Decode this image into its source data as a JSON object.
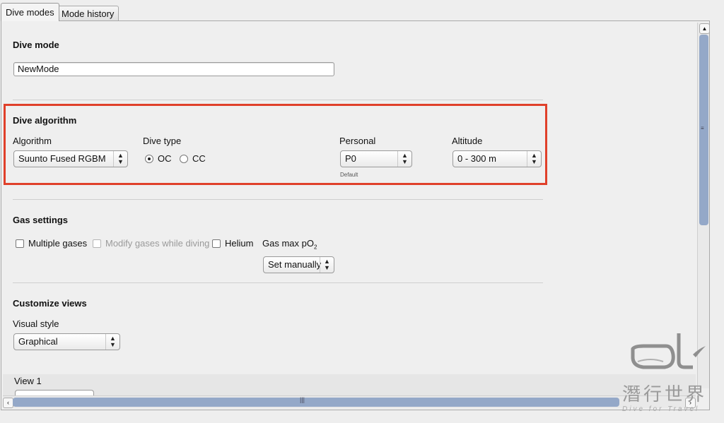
{
  "tabs": {
    "active": "Dive modes",
    "inactive": "Mode history"
  },
  "dive_mode": {
    "title": "Dive mode",
    "value": "NewMode"
  },
  "dive_algorithm": {
    "title": "Dive algorithm",
    "algorithm_label": "Algorithm",
    "algorithm_value": "Suunto Fused RGBM",
    "dive_type_label": "Dive type",
    "dive_type_options": [
      "OC",
      "CC"
    ],
    "dive_type_selected": "OC",
    "personal_label": "Personal",
    "personal_value": "P0",
    "personal_hint": "Default",
    "altitude_label": "Altitude",
    "altitude_value": "0 - 300 m"
  },
  "gas_settings": {
    "title": "Gas settings",
    "multiple_gases": "Multiple gases",
    "modify_gases": "Modify gases while diving",
    "helium": "Helium",
    "gas_max_po2_label": "Gas max pO",
    "gas_max_po2_sub": "2",
    "gas_max_po2_value": "Set manually"
  },
  "customize_views": {
    "title": "Customize views",
    "visual_style_label": "Visual style",
    "visual_style_value": "Graphical",
    "view1_label": "View 1"
  },
  "watermark": {
    "cn": "潛行世界",
    "en": "Dive for Travel"
  },
  "colors": {
    "highlight": "#e0402a",
    "scroll_thumb": "#94a8c8"
  }
}
